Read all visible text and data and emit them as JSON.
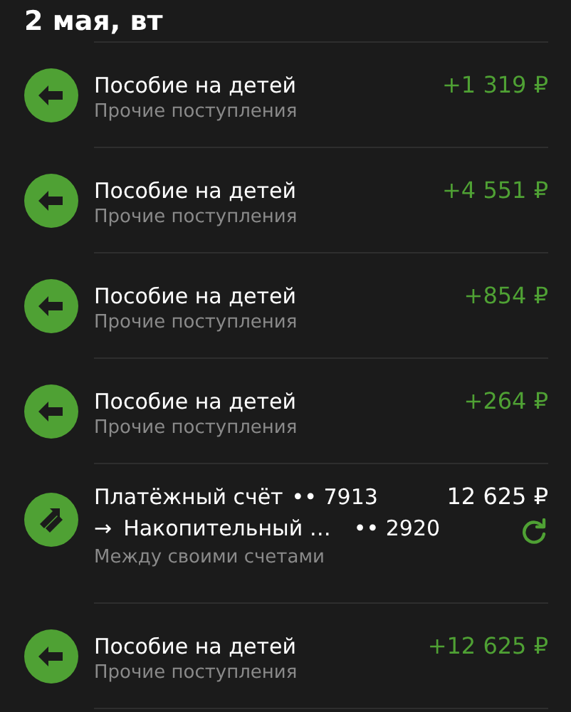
{
  "date_header": "2 мая, вт",
  "operations": [
    {
      "kind": "incoming",
      "title": "Пособие на детей",
      "category": "Прочие поступления",
      "amount": "+1 319 ₽"
    },
    {
      "kind": "incoming",
      "title": "Пособие на детей",
      "category": "Прочие поступления",
      "amount": "+4 551 ₽"
    },
    {
      "kind": "incoming",
      "title": "Пособие на детей",
      "category": "Прочие поступления",
      "amount": "+854 ₽"
    },
    {
      "kind": "incoming",
      "title": "Пособие на детей",
      "category": "Прочие поступления",
      "amount": "+264 ₽"
    },
    {
      "kind": "transfer",
      "title": "Платёжный счёт",
      "from_account": "•• 7913",
      "arrow": "→",
      "to_title": "Накопительный …",
      "to_account": "•• 2920",
      "category": "Между своими счетами",
      "amount": "12 625 ₽"
    },
    {
      "kind": "incoming",
      "title": "Пособие на детей",
      "category": "Прочие поступления",
      "amount": "+12 625 ₽"
    }
  ]
}
